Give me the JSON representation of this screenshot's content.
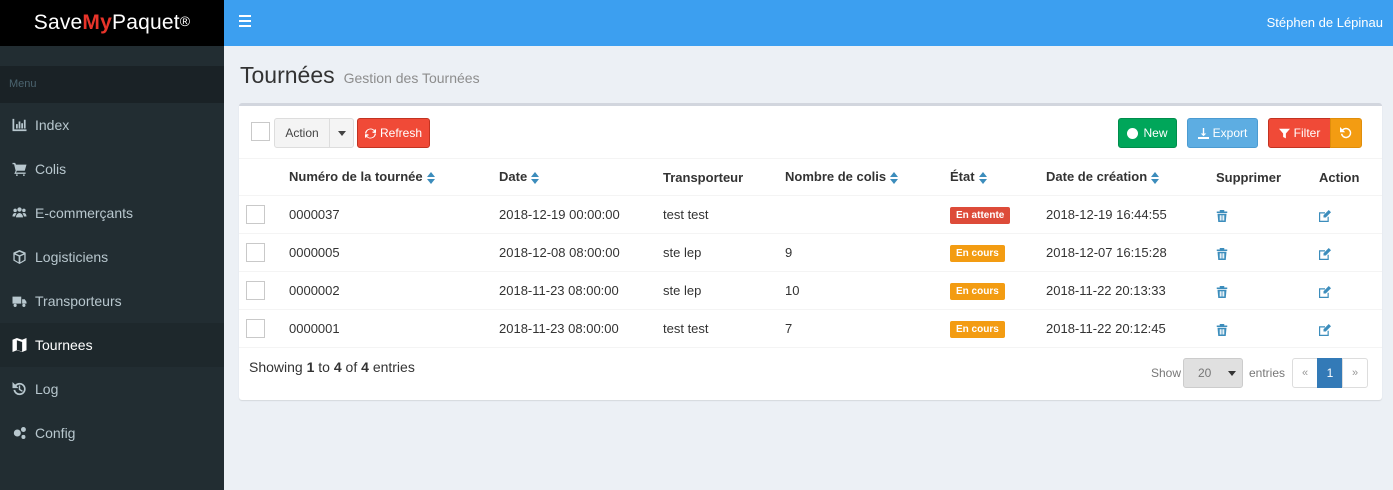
{
  "brand": {
    "part1": "Save",
    "part2": "My",
    "part3": "Paquet",
    "reg": "®"
  },
  "topbar": {
    "user": "Stéphen de Lépinau"
  },
  "sidebar": {
    "header": "Menu",
    "items": [
      {
        "label": "Index",
        "icon": "bar-chart-icon"
      },
      {
        "label": "Colis",
        "icon": "cart-icon"
      },
      {
        "label": "E-commerçants",
        "icon": "users-icon"
      },
      {
        "label": "Logisticiens",
        "icon": "cube-icon"
      },
      {
        "label": "Transporteurs",
        "icon": "truck-icon"
      },
      {
        "label": "Tournees",
        "icon": "map-icon",
        "active": true
      },
      {
        "label": "Log",
        "icon": "history-icon"
      },
      {
        "label": "Config",
        "icon": "cogs-icon"
      }
    ]
  },
  "page": {
    "title": "Tournées",
    "subtitle": "Gestion des Tournées"
  },
  "toolbar": {
    "action_label": "Action",
    "refresh_label": "Refresh",
    "new_label": "New",
    "export_label": "Export",
    "filter_label": "Filter"
  },
  "table": {
    "columns": [
      "Numéro de la tournée",
      "Date",
      "Transporteur",
      "Nombre de colis",
      "État",
      "Date de création",
      "Supprimer",
      "Action"
    ],
    "rows": [
      {
        "numero": "0000037",
        "date": "2018-12-19 00:00:00",
        "transporteur": "test test",
        "colis": "",
        "etat": "En attente",
        "creation": "2018-12-19 16:44:55"
      },
      {
        "numero": "0000005",
        "date": "2018-12-08 08:00:00",
        "transporteur": "ste lep",
        "colis": "9",
        "etat": "En cours",
        "creation": "2018-12-07 16:15:28"
      },
      {
        "numero": "0000002",
        "date": "2018-11-23 08:00:00",
        "transporteur": "ste lep",
        "colis": "10",
        "etat": "En cours",
        "creation": "2018-11-22 20:13:33"
      },
      {
        "numero": "0000001",
        "date": "2018-11-23 08:00:00",
        "transporteur": "test test",
        "colis": "7",
        "etat": "En cours",
        "creation": "2018-11-22 20:12:45"
      }
    ]
  },
  "status_colors": {
    "En attente": "#dd4b39",
    "En cours": "#f39c12"
  },
  "footer": {
    "showing": "Showing",
    "from": "1",
    "to_word": "to",
    "to": "4",
    "of_word": "of",
    "total": "4",
    "entries_word": "entries",
    "show_label": "Show",
    "page_size": "20",
    "entries_label": "entries",
    "prev": "«",
    "current_page": "1",
    "next": "»"
  }
}
